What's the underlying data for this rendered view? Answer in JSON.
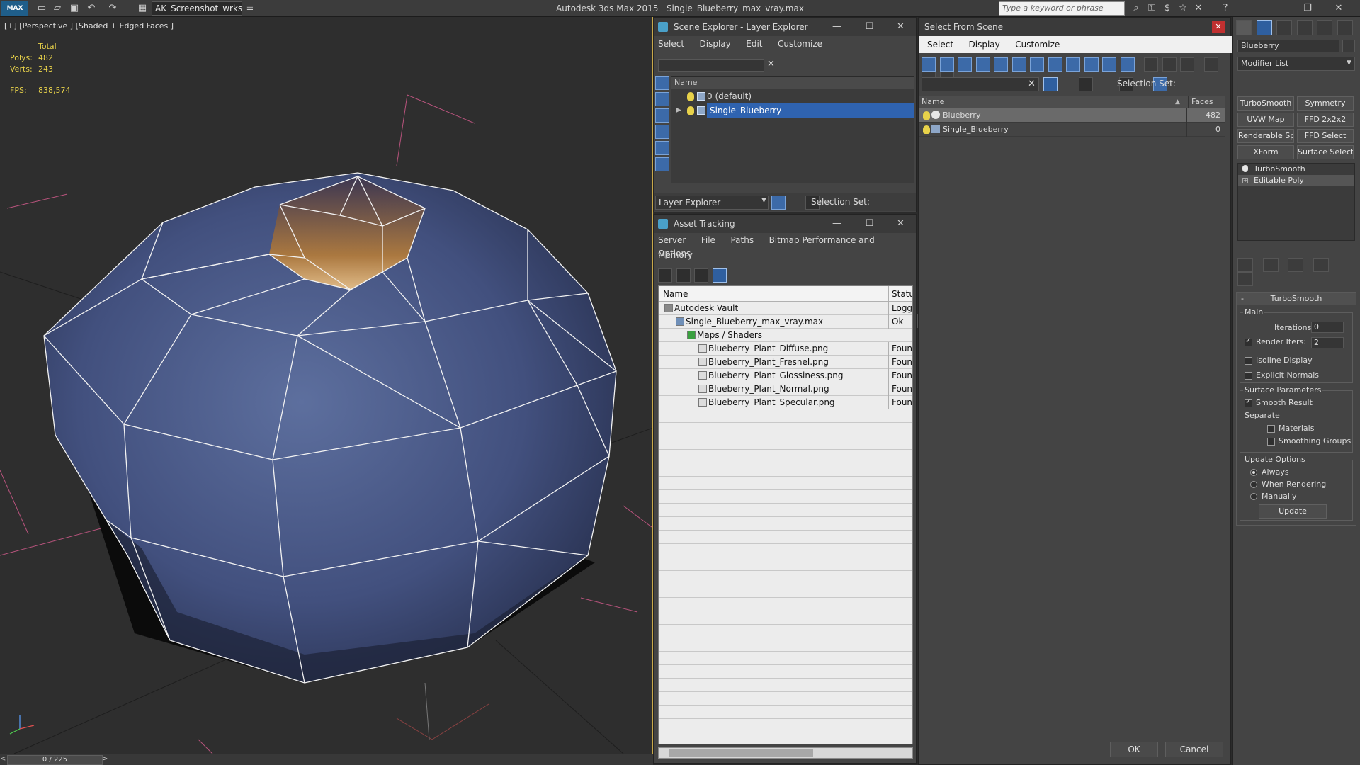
{
  "titlebar": {
    "logo": "MAX",
    "workspace": "AK_Screenshot_wrksp",
    "app": "Autodesk 3ds Max  2015",
    "file": "Single_Blueberry_max_vray.max",
    "search_placeholder": "Type a keyword or phrase"
  },
  "viewport": {
    "label": "[+] [Perspective ] [Shaded + Edged Faces ]",
    "stats": {
      "total_label": "Total",
      "polys_label": "Polys:",
      "polys": "482",
      "verts_label": "Verts:",
      "verts": "243",
      "fps_label": "FPS:",
      "fps": "838,574"
    }
  },
  "timeline": {
    "position": "0 / 225"
  },
  "scene_explorer": {
    "title": "Scene Explorer - Layer Explorer",
    "menu": [
      "Select",
      "Display",
      "Edit",
      "Customize"
    ],
    "column": "Name",
    "layers": [
      {
        "name": "0 (default)",
        "selected": false
      },
      {
        "name": "Single_Blueberry",
        "selected": true
      }
    ],
    "explorer_dropdown": "Layer Explorer",
    "selection_set_label": "Selection Set:"
  },
  "asset_tracking": {
    "title": "Asset Tracking",
    "menu": [
      "Server",
      "File",
      "Paths",
      "Bitmap Performance and Memory"
    ],
    "menu2": "Options",
    "columns": {
      "name": "Name",
      "status": "Status"
    },
    "rows": [
      {
        "name": "Autodesk Vault",
        "status": "Logged",
        "indent": 0
      },
      {
        "name": "Single_Blueberry_max_vray.max",
        "status": "Ok",
        "indent": 1
      },
      {
        "name": "Maps / Shaders",
        "status": "",
        "indent": 2
      },
      {
        "name": "Blueberry_Plant_Diffuse.png",
        "status": "Found",
        "indent": 3
      },
      {
        "name": "Blueberry_Plant_Fresnel.png",
        "status": "Found",
        "indent": 3
      },
      {
        "name": "Blueberry_Plant_Glossiness.png",
        "status": "Found",
        "indent": 3
      },
      {
        "name": "Blueberry_Plant_Normal.png",
        "status": "Found",
        "indent": 3
      },
      {
        "name": "Blueberry_Plant_Specular.png",
        "status": "Found",
        "indent": 3
      }
    ]
  },
  "select_from_scene": {
    "title": "Select From Scene",
    "menu": [
      "Select",
      "Display",
      "Customize"
    ],
    "selection_set_label": "Selection Set:",
    "columns": {
      "name": "Name",
      "faces": "Faces"
    },
    "rows": [
      {
        "name": "Blueberry",
        "faces": "482",
        "selected": true
      },
      {
        "name": "Single_Blueberry",
        "faces": "0",
        "selected": false
      }
    ],
    "ok": "OK",
    "cancel": "Cancel"
  },
  "command_panel": {
    "object_name": "Blueberry",
    "modifier_list": "Modifier List",
    "modifier_buttons": [
      "TurboSmooth",
      "Symmetry",
      "UVW Map",
      "FFD 2x2x2",
      "Renderable Spline",
      "FFD Select",
      "XForm",
      "Surface Select"
    ],
    "stack": [
      "TurboSmooth",
      "Editable Poly"
    ],
    "turbosmooth": {
      "title": "TurboSmooth",
      "main_label": "Main",
      "iterations_label": "Iterations:",
      "iterations": "0",
      "render_iters_label": "Render Iters:",
      "render_iters": "2",
      "isoline": "Isoline Display",
      "explicit_normals": "Explicit Normals",
      "surface_params": "Surface Parameters",
      "smooth_result": "Smooth Result",
      "separate": "Separate",
      "materials": "Materials",
      "smoothing_groups": "Smoothing Groups",
      "update_options": "Update Options",
      "always": "Always",
      "when_rendering": "When Rendering",
      "manually": "Manually",
      "update": "Update"
    }
  },
  "colors": {
    "accent_select": "#2f63b0",
    "stats": "#e8d24a",
    "viewport_border": "#c8a84a"
  }
}
